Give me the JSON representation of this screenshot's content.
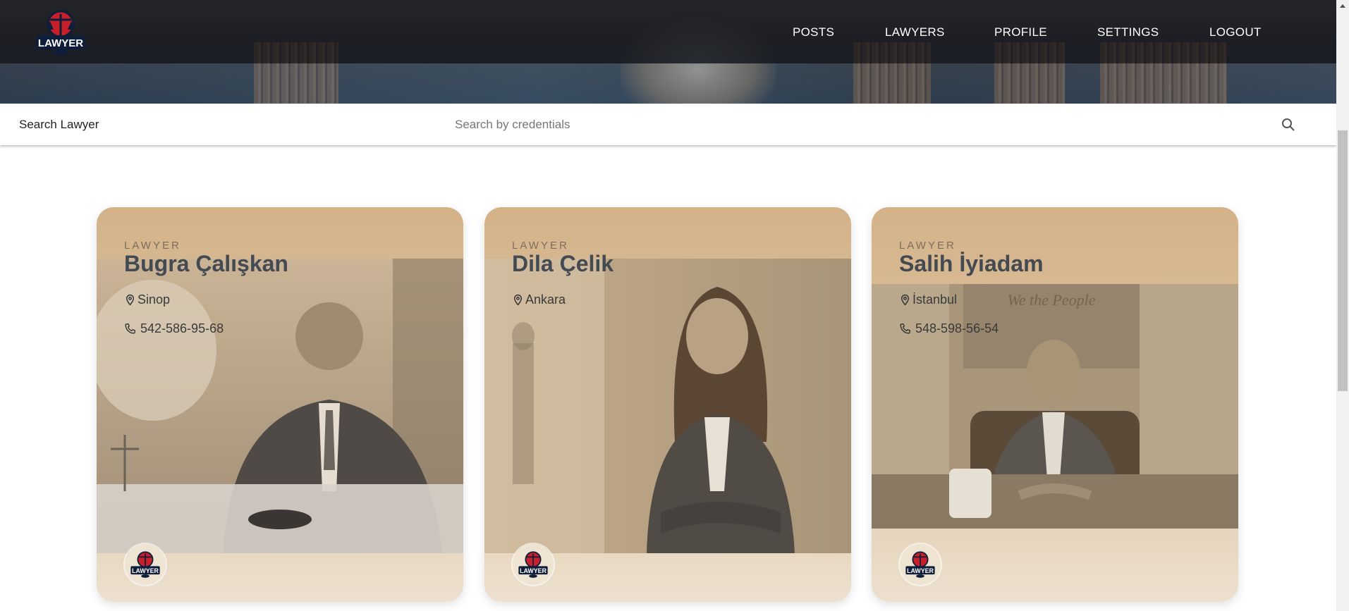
{
  "nav": {
    "logo_alt": "Lawyer",
    "items": [
      "POSTS",
      "LAWYERS",
      "PROFILE",
      "SETTINGS",
      "LOGOUT"
    ]
  },
  "search": {
    "title": "Search Lawyer",
    "placeholder": "Search by credentials",
    "value": ""
  },
  "icons": {
    "search": "search-icon",
    "location": "map-pin-icon",
    "phone": "phone-icon",
    "logo": "scales-of-justice-logo"
  },
  "colors": {
    "nav_bg": "#11161e",
    "card_top": "#d3b288",
    "card_bottom": "#ece0cf",
    "name": "#444a52",
    "logo_red": "#c8202a",
    "logo_navy": "#0d1d3a"
  },
  "lawyers": [
    {
      "label": "LAWYER",
      "name": "Bugra Çalışkan",
      "city": "Sinop",
      "phone": "542-586-95-68"
    },
    {
      "label": "LAWYER",
      "name": "Dila Çelik",
      "city": "Ankara",
      "phone": ""
    },
    {
      "label": "LAWYER",
      "name": "Salih İyiadam",
      "city": "İstanbul",
      "phone": "548-598-56-54"
    }
  ]
}
